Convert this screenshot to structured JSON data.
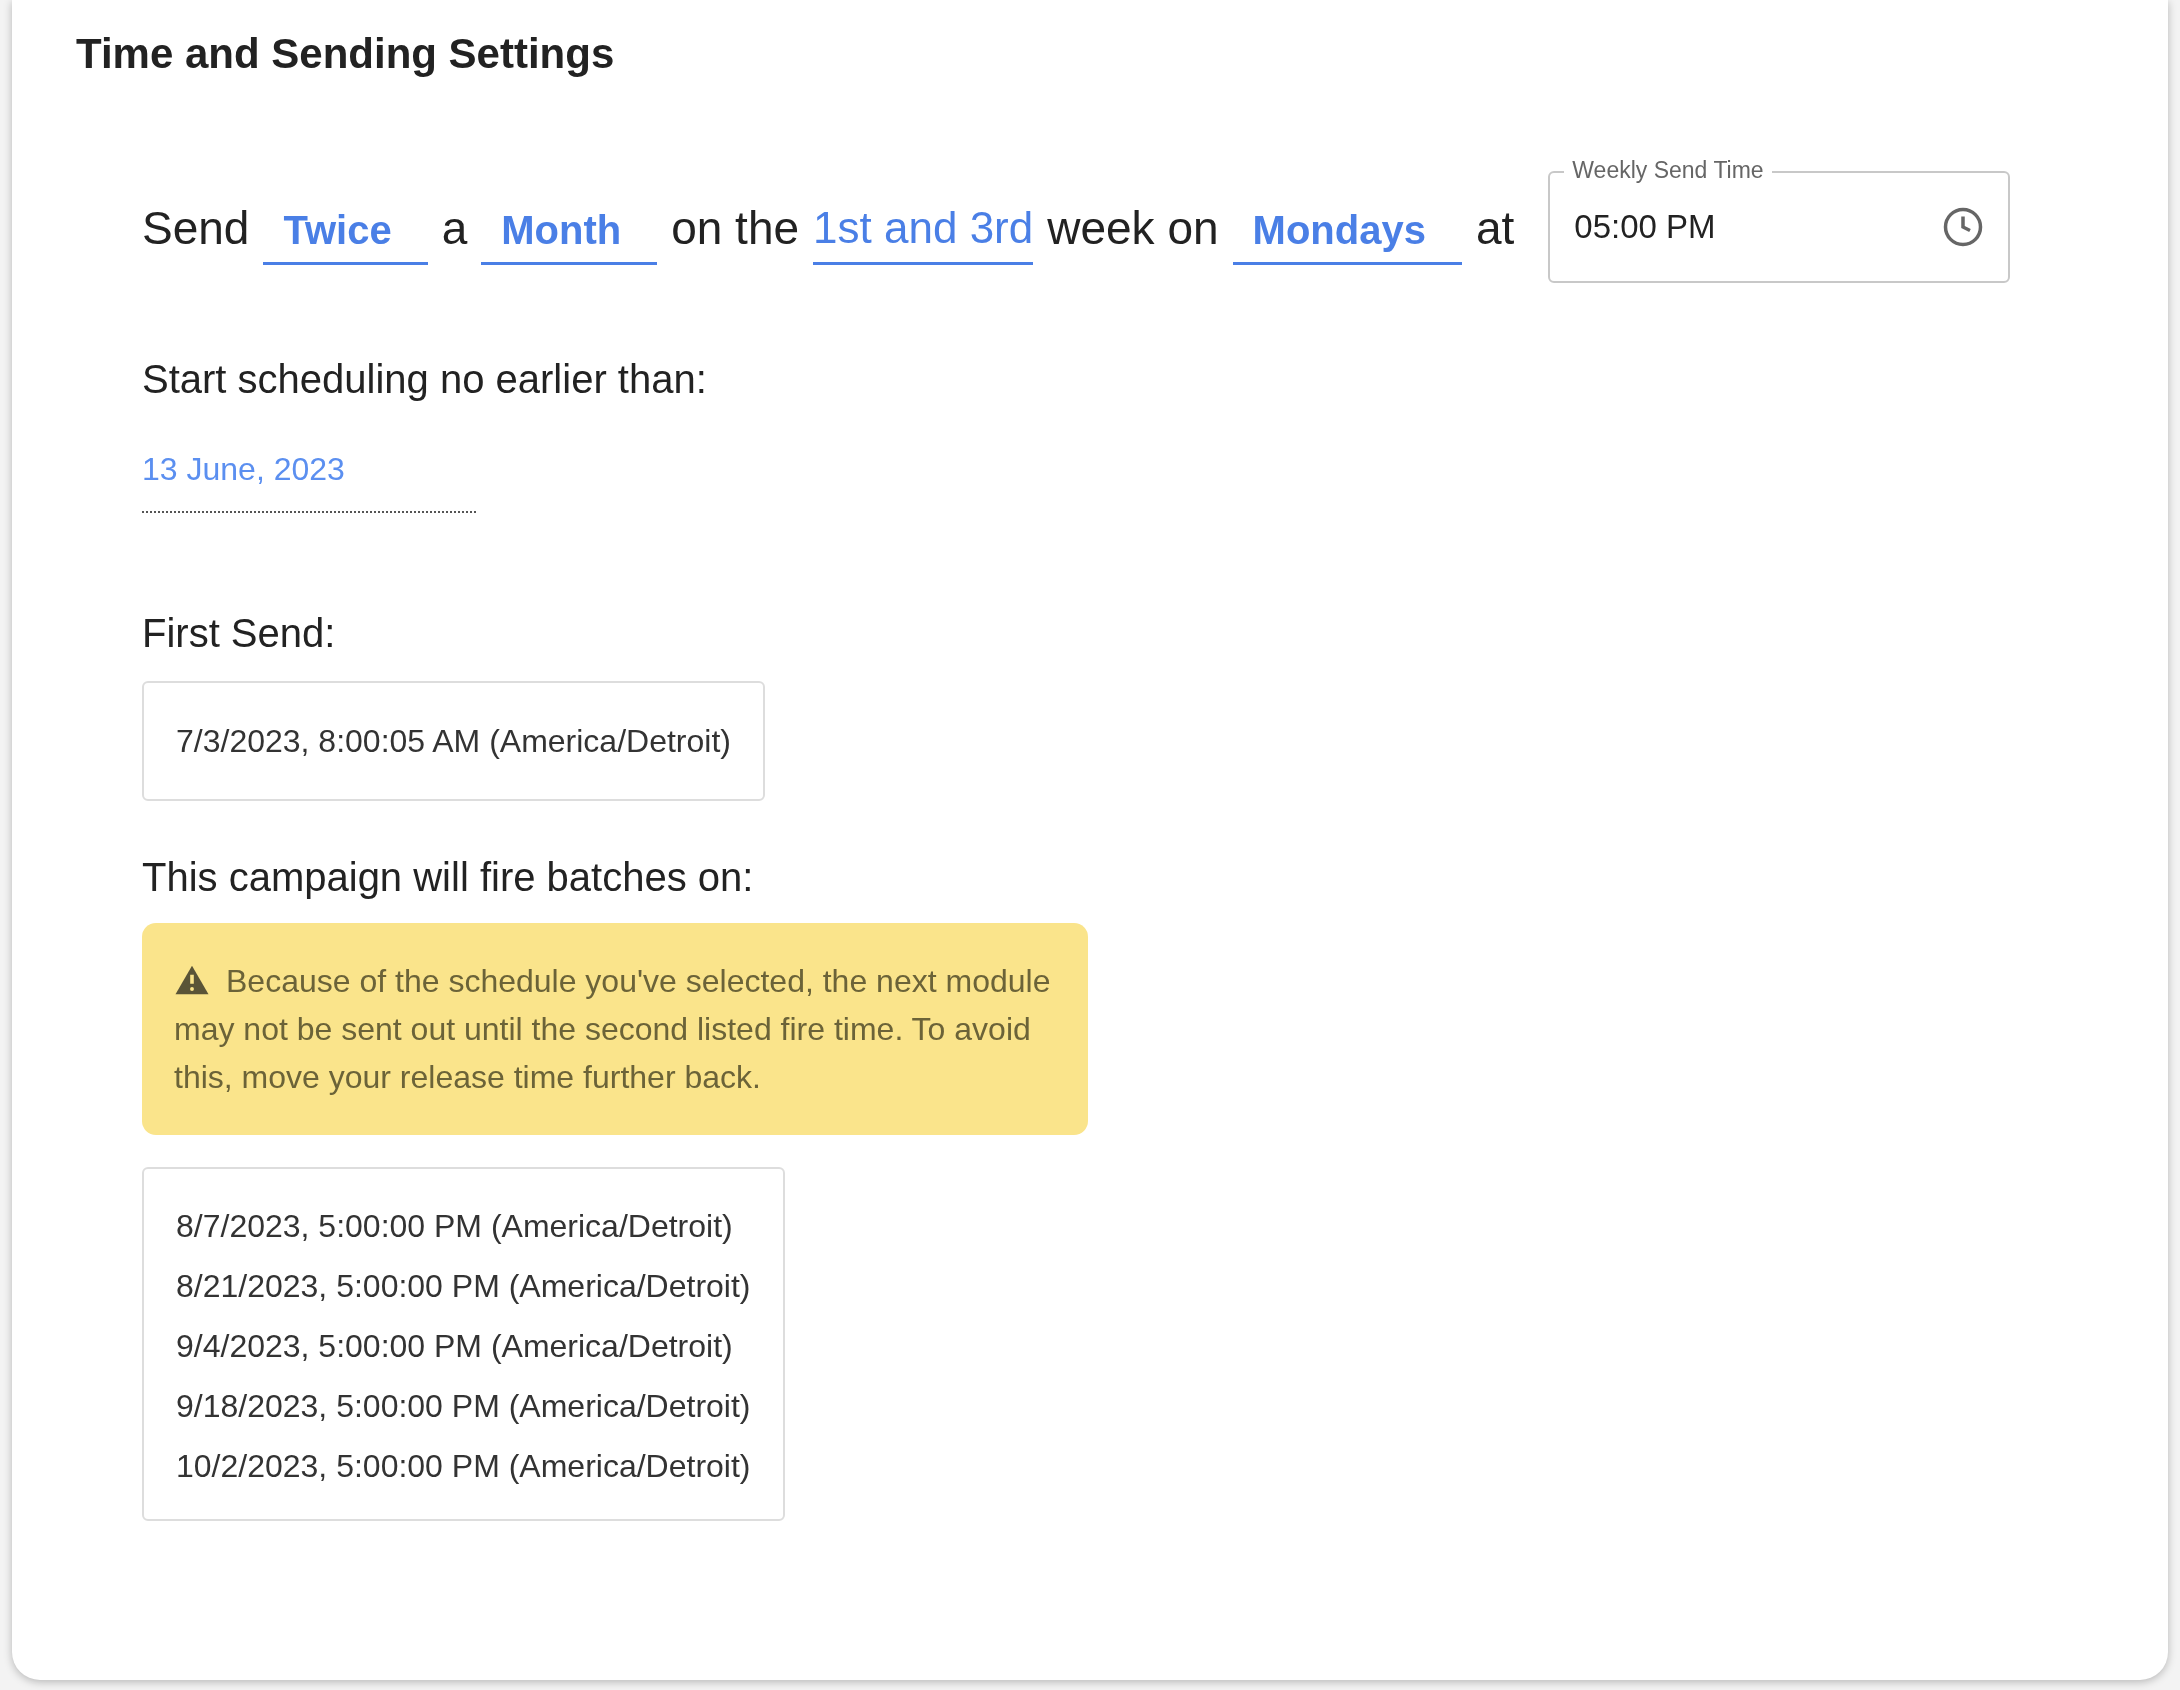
{
  "title": "Time and Sending Settings",
  "schedule": [
    {
      "kind": "text",
      "text": "Send"
    },
    {
      "kind": "select",
      "value": "Twice"
    },
    {
      "kind": "text",
      "text": "a"
    },
    {
      "kind": "select",
      "value": "Month"
    },
    {
      "kind": "text",
      "text": "on the"
    },
    {
      "kind": "link",
      "value": "1st and 3rd"
    },
    {
      "kind": "text",
      "text": "week on"
    },
    {
      "kind": "select",
      "value": "Mondays"
    },
    {
      "kind": "text",
      "text": "at"
    }
  ],
  "time_field": {
    "label": "Weekly Send Time",
    "value": "05:00 PM"
  },
  "start": {
    "label": "Start scheduling no earlier than:",
    "date": "13 June, 2023"
  },
  "first_send": {
    "label": "First Send:",
    "value": "7/3/2023, 8:00:05 AM (America/Detroit)"
  },
  "batches": {
    "label": "This campaign will fire batches on:",
    "warning": "Because of the schedule you've selected, the next module may not be sent out until the second listed fire time. To avoid this, move your release time further back.",
    "times": [
      "8/7/2023, 5:00:00 PM (America/Detroit)",
      "8/21/2023, 5:00:00 PM (America/Detroit)",
      "9/4/2023, 5:00:00 PM (America/Detroit)",
      "9/18/2023, 5:00:00 PM (America/Detroit)",
      "10/2/2023, 5:00:00 PM (America/Detroit)"
    ]
  }
}
